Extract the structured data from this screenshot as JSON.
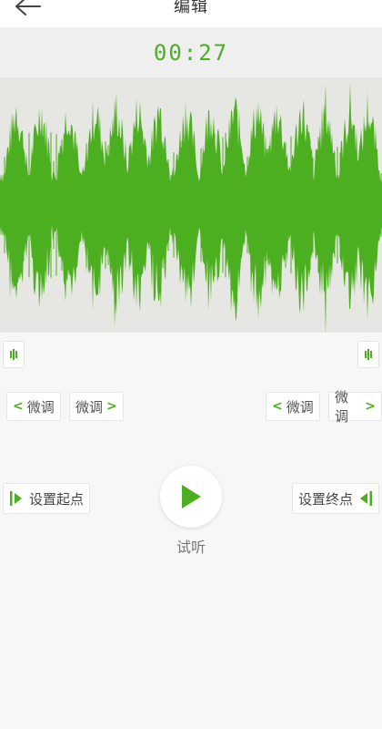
{
  "header": {
    "title": "编辑",
    "back_icon": "arrow-left-icon"
  },
  "player": {
    "time": "00:27",
    "position_label": ""
  },
  "controls": {
    "fine_left_1": "微调",
    "fine_right_1": "微调",
    "fine_left_2": "微调",
    "fine_right_2": "微调",
    "set_start": "设置起点",
    "set_end": "设置终点",
    "play_label": "试听"
  },
  "colors": {
    "accent": "#4caf1f",
    "wave_bg": "#e6e6e2",
    "page_bg": "#f7f7f7"
  }
}
